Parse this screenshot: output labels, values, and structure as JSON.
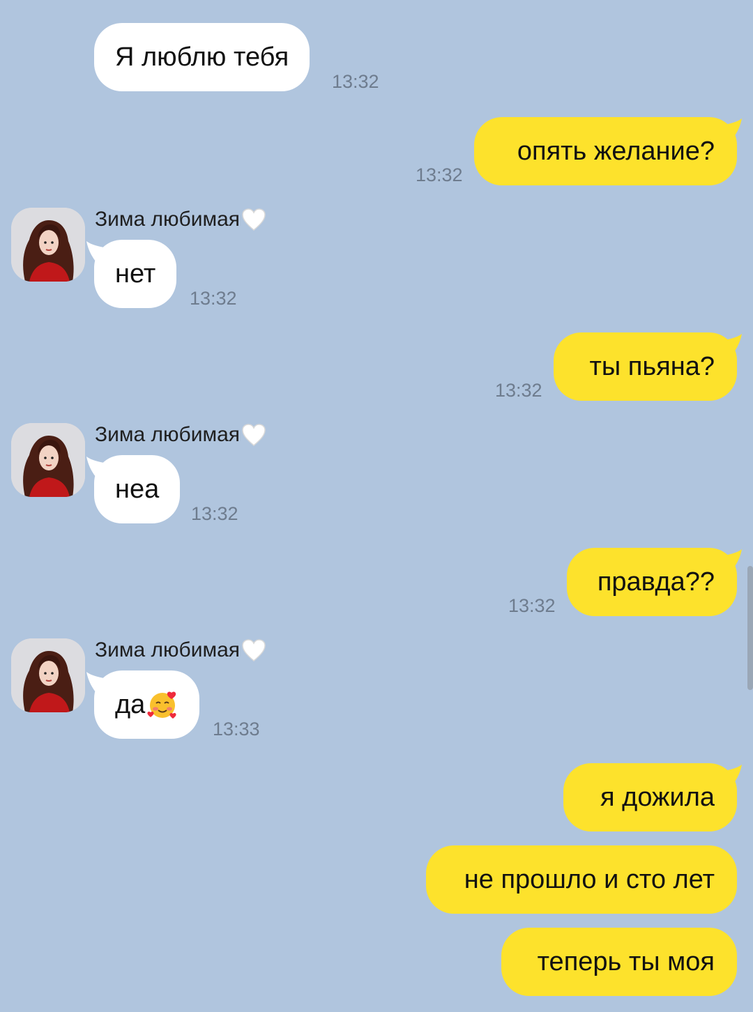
{
  "colors": {
    "background": "#b0c5de",
    "incoming_bubble": "#ffffff",
    "outgoing_bubble": "#fde22c",
    "timestamp": "#6e7c8e"
  },
  "contact": {
    "name": "Зима любимая",
    "name_suffix_icon": "white-heart-icon"
  },
  "messages": [
    {
      "direction": "in",
      "text": "Я люблю тебя",
      "time": "13:32"
    },
    {
      "direction": "out",
      "text": "опять желание?",
      "time": "13:32"
    },
    {
      "direction": "in",
      "sender": "Зима любимая",
      "text": "нет",
      "time": "13:32"
    },
    {
      "direction": "out",
      "text": "ты пьяна?",
      "time": "13:32"
    },
    {
      "direction": "in",
      "sender": "Зима любимая",
      "text": "неа",
      "time": "13:32"
    },
    {
      "direction": "out",
      "text": "правда??",
      "time": "13:32"
    },
    {
      "direction": "in",
      "sender": "Зима любимая",
      "text": "да",
      "emoji": "smiling-face-with-hearts-icon",
      "time": "13:33"
    },
    {
      "direction": "out",
      "text": "я дожила"
    },
    {
      "direction": "out",
      "text": "не прошло и сто лет"
    },
    {
      "direction": "out",
      "text": "теперь ты моя"
    }
  ]
}
